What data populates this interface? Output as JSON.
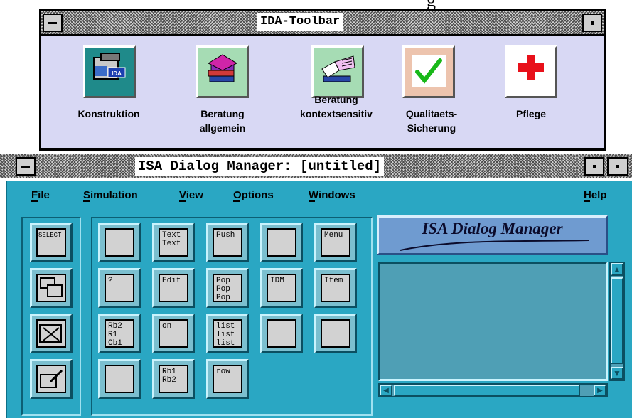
{
  "ida_toolbar": {
    "title": "IDA-Toolbar",
    "items": [
      {
        "label": "Konstruktion",
        "icon": "construction-ida-icon"
      },
      {
        "label": "Beratung\nallgemein",
        "icon": "books-icon"
      },
      {
        "label": "Beratung\nkontextsensitiv",
        "icon": "open-book-icon"
      },
      {
        "label": "Qualitaets-\nSicherung",
        "icon": "checkmark-icon"
      },
      {
        "label": "Pflege",
        "icon": "red-cross-icon"
      }
    ],
    "colors": {
      "background": "#d8d8f4",
      "check": "#18b818",
      "cross": "#e8101a"
    }
  },
  "isa_window": {
    "title": "ISA Dialog Manager:  [untitled]",
    "menu": [
      {
        "label": "File"
      },
      {
        "label": "Simulation"
      },
      {
        "label": "View"
      },
      {
        "label": "Options"
      },
      {
        "label": "Windows"
      },
      {
        "label": "Help"
      }
    ],
    "logo_text": "ISA Dialog Manager",
    "left_tools": [
      {
        "name": "select-tool",
        "text": "SELECT"
      },
      {
        "name": "window-tool",
        "text": ""
      },
      {
        "name": "delete-tool",
        "text": ""
      },
      {
        "name": "layout-tool",
        "text": ""
      }
    ],
    "palette": [
      {
        "name": "window-object",
        "text": ""
      },
      {
        "name": "text-object",
        "text": "Text\nText"
      },
      {
        "name": "pushbutton-object",
        "text": "Push"
      },
      {
        "name": "image-object",
        "text": ""
      },
      {
        "name": "menu-object",
        "text": "Menu"
      },
      {
        "name": "messagebox-object",
        "text": "?"
      },
      {
        "name": "edit-object",
        "text": "Edit"
      },
      {
        "name": "popup-object",
        "text": "Pop\nPop\nPop\nPop"
      },
      {
        "name": "idm-object",
        "text": "IDM"
      },
      {
        "name": "item-object",
        "text": "Item"
      },
      {
        "name": "group-object",
        "text": "Rb2\nR1\nCb1"
      },
      {
        "name": "checkbox-object",
        "text": "on"
      },
      {
        "name": "listbox-object",
        "text": "list\nlist\nlist"
      },
      {
        "name": "scrollbar-object",
        "text": ""
      },
      {
        "name": "tree-object",
        "text": ""
      },
      {
        "name": "container-object",
        "text": ""
      },
      {
        "name": "radiobutton-object",
        "text": "Rb1\nRb2"
      },
      {
        "name": "table-object",
        "text": "row"
      }
    ],
    "colors": {
      "body": "#2aa7c3",
      "logo": "#6f9bd0",
      "list": "#4f9fb5"
    }
  }
}
